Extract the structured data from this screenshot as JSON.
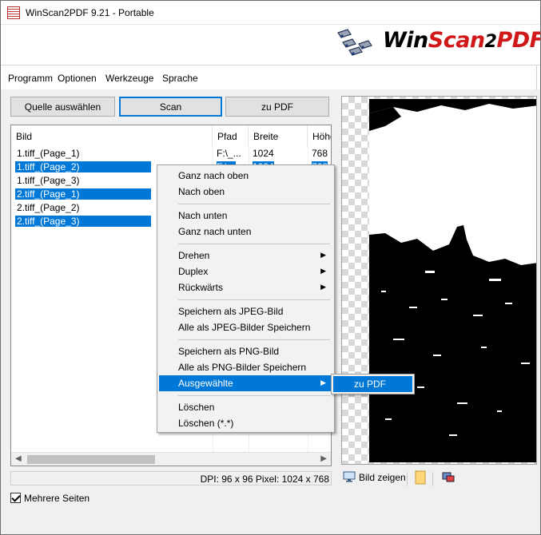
{
  "window": {
    "title": "WinScan2PDF 9.21 - Portable",
    "icon": "app-icon"
  },
  "logo": {
    "part1": "Win",
    "part2": "Scan",
    "part3": "2",
    "part4": "PDF",
    "colors": {
      "dark": "#111111",
      "red": "#d01818"
    }
  },
  "menu": {
    "items": [
      "Programm",
      "Optionen",
      "Werkzeuge",
      "Sprache"
    ]
  },
  "toolbar": {
    "source_label": "Quelle auswählen",
    "scan_label": "Scan",
    "pdf_label": "zu PDF"
  },
  "list": {
    "columns": [
      "Bild",
      "Pfad",
      "Breite",
      "Höhe"
    ],
    "rows": [
      {
        "bild": "1.tiff_(Page_1)",
        "pfad": "F:\\_...",
        "breite": "1024",
        "hoehe": "768",
        "selected": false
      },
      {
        "bild": "1.tiff_(Page_2)",
        "pfad": "F:\\...",
        "breite": "1024",
        "hoehe": "768",
        "selected": true
      },
      {
        "bild": "1.tiff_(Page_3)",
        "pfad": "",
        "breite": "",
        "hoehe": "",
        "selected": false
      },
      {
        "bild": "2.tiff_(Page_1)",
        "pfad": "",
        "breite": "",
        "hoehe": "",
        "selected": true
      },
      {
        "bild": "2.tiff_(Page_2)",
        "pfad": "",
        "breite": "",
        "hoehe": "",
        "selected": false
      },
      {
        "bild": "2.tiff_(Page_3)",
        "pfad": "",
        "breite": "",
        "hoehe": "",
        "selected": true
      }
    ]
  },
  "status": {
    "text": "DPI: 96 x 96 Pixel: 1024 x 768"
  },
  "options": {
    "multi_pages_label": "Mehrere Seiten",
    "multi_pages_checked": true
  },
  "preview": {
    "show_image_label": "Bild zeigen"
  },
  "context_menu": {
    "items": [
      "Ganz nach oben",
      "Nach oben",
      "Nach unten",
      "Ganz nach unten",
      "Drehen",
      "Duplex",
      "Rückwärts",
      "Speichern als JPEG-Bild",
      "Alle als JPEG-Bilder Speichern",
      "Speichern als PNG-Bild",
      "Alle als PNG-Bilder Speichern",
      "Ausgewählte",
      "Löschen",
      "Löschen (*.*)"
    ],
    "highlighted": "Ausgewählte",
    "submenu": {
      "items": [
        "zu PDF"
      ]
    }
  },
  "colors": {
    "selection": "#0078d7",
    "menu_bg": "#f2f2f2",
    "window_bg": "#f0f0f0"
  }
}
